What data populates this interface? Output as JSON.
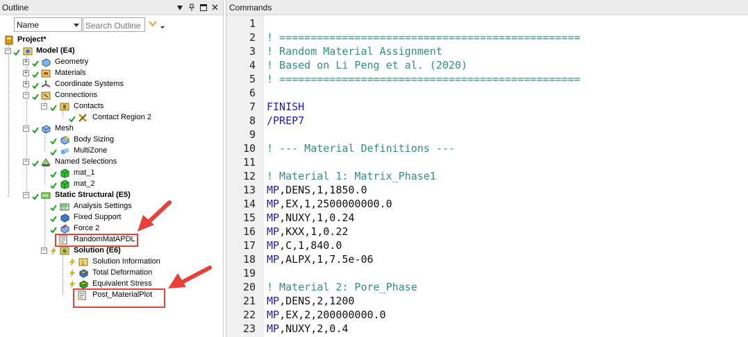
{
  "outline": {
    "title": "Outline",
    "header_icons": [
      "pin-icon",
      "float-icon",
      "close-icon"
    ],
    "name_select": "Name",
    "search_placeholder": "Search Outline",
    "tree": {
      "project": "Project*",
      "model": "Model (E4)",
      "geometry": "Geometry",
      "materials": "Materials",
      "coordinate_systems": "Coordinate Systems",
      "connections": "Connections",
      "contacts": "Contacts",
      "contact_region": "Contact Region 2",
      "mesh": "Mesh",
      "body_sizing": "Body Sizing",
      "multizone": "MultiZone",
      "named_selections": "Named Selections",
      "mat_1": "mat_1",
      "mat_2": "mat_2",
      "static_structural": "Static Structural (E5)",
      "analysis_settings": "Analysis Settings",
      "fixed_support": "Fixed Support",
      "force_2": "Force 2",
      "random_mat_apdl": "RandomMatAPDL",
      "solution": "Solution (E6)",
      "solution_information": "Solution Information",
      "total_deformation": "Total Deformation",
      "equivalent_stress": "Equivalent Stress",
      "post_material_plot": "Post_MaterialPlot"
    }
  },
  "commands": {
    "title": "Commands",
    "lines": [
      {
        "n": "1",
        "kind": "norm",
        "text": ""
      },
      {
        "n": "2",
        "kind": "comment",
        "text": "! ================================================"
      },
      {
        "n": "3",
        "kind": "comment",
        "text": "! Random Material Assignment"
      },
      {
        "n": "4",
        "kind": "comment",
        "text": "! Based on Li Peng et al. (2020)"
      },
      {
        "n": "5",
        "kind": "comment",
        "text": "! ================================================"
      },
      {
        "n": "6",
        "kind": "norm",
        "text": ""
      },
      {
        "n": "7",
        "kind": "kw",
        "text": "FINISH"
      },
      {
        "n": "8",
        "kind": "kw",
        "text": "/PREP7"
      },
      {
        "n": "9",
        "kind": "norm",
        "text": ""
      },
      {
        "n": "10",
        "kind": "comment",
        "text": "! --- Material Definitions ---"
      },
      {
        "n": "11",
        "kind": "norm",
        "text": ""
      },
      {
        "n": "12",
        "kind": "comment",
        "text": "! Material 1: Matrix_Phase1"
      },
      {
        "n": "13",
        "kind": "mp",
        "kw": "MP",
        "rest": ",DENS,1,1850.0"
      },
      {
        "n": "14",
        "kind": "mp",
        "kw": "MP",
        "rest": ",EX,1,2500000000.0"
      },
      {
        "n": "15",
        "kind": "mp",
        "kw": "MP",
        "rest": ",NUXY,1,0.24"
      },
      {
        "n": "16",
        "kind": "mp",
        "kw": "MP",
        "rest": ",KXX,1,0.22"
      },
      {
        "n": "17",
        "kind": "mp",
        "kw": "MP",
        "rest": ",C,1,840.0"
      },
      {
        "n": "18",
        "kind": "mp",
        "kw": "MP",
        "rest": ",ALPX,1,7.5e-06"
      },
      {
        "n": "19",
        "kind": "norm",
        "text": ""
      },
      {
        "n": "20",
        "kind": "comment",
        "text": "! Material 2: Pore_Phase"
      },
      {
        "n": "21",
        "kind": "mp",
        "kw": "MP",
        "rest": ",DENS,2,1200"
      },
      {
        "n": "22",
        "kind": "mp",
        "kw": "MP",
        "rest": ",EX,2,200000000.0"
      },
      {
        "n": "23",
        "kind": "mp",
        "kw": "MP",
        "rest": ",NUXY,2,0.4"
      }
    ]
  },
  "colors": {
    "comment": "#2f8f84",
    "keyword": "#1a1ad0",
    "highlight": "#e8413a",
    "check": "#1aa11a",
    "lightning": "#e6c21a"
  }
}
